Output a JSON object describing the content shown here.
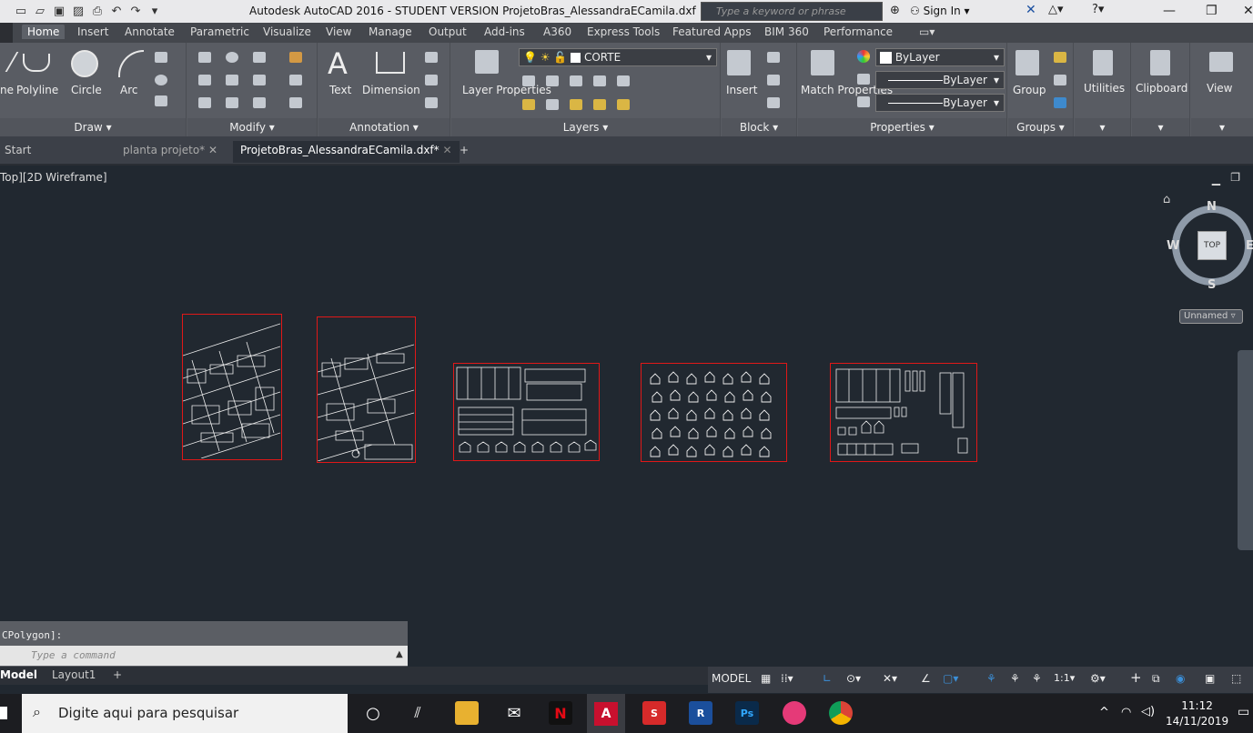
{
  "title_bar": {
    "app_title": "Autodesk AutoCAD 2016 - STUDENT VERSION    ProjetoBras_AlessandraECamila.dxf",
    "search_placeholder": "Type a keyword or phrase",
    "sign_in": "Sign In"
  },
  "ribbon_tabs": [
    "Home",
    "Insert",
    "Annotate",
    "Parametric",
    "Visualize",
    "View",
    "Manage",
    "Output",
    "Add-ins",
    "A360",
    "Express Tools",
    "Featured Apps",
    "BIM 360",
    "Performance"
  ],
  "ribbon": {
    "draw": {
      "title": "Draw",
      "polyline": "Polyline",
      "circle": "Circle",
      "arc": "Arc",
      "line_partial": "ne"
    },
    "modify": {
      "title": "Modify"
    },
    "annotation": {
      "title": "Annotation",
      "text": "Text",
      "dimension": "Dimension"
    },
    "layers": {
      "title": "Layers",
      "layer_properties": "Layer Properties",
      "current_layer": "CORTE"
    },
    "block": {
      "title": "Block",
      "insert": "Insert"
    },
    "properties": {
      "title": "Properties",
      "match_properties": "Match Properties",
      "color": "ByLayer",
      "linetype": "ByLayer",
      "lineweight": "ByLayer"
    },
    "groups": {
      "title": "Groups",
      "group": "Group"
    },
    "utilities": "Utilities",
    "clipboard": "Clipboard",
    "view": "View"
  },
  "doc_tabs": [
    "Start",
    "planta projeto*",
    "ProjetoBras_AlessandraECamila.dxf*"
  ],
  "canvas": {
    "viewport_label": "Top][2D Wireframe]",
    "viewcube": {
      "top": "TOP",
      "n": "N",
      "s": "S",
      "e": "E",
      "w": "W",
      "ucs": "Unnamed"
    }
  },
  "command": {
    "history": "CPolygon]:",
    "placeholder": "Type a command"
  },
  "layout_tabs": [
    "Model",
    "Layout1"
  ],
  "status_bar": {
    "model": "MODEL",
    "scale": "1:1"
  },
  "taskbar": {
    "search": "Digite aqui para pesquisar",
    "time": "11:12",
    "date": "14/11/2019"
  }
}
